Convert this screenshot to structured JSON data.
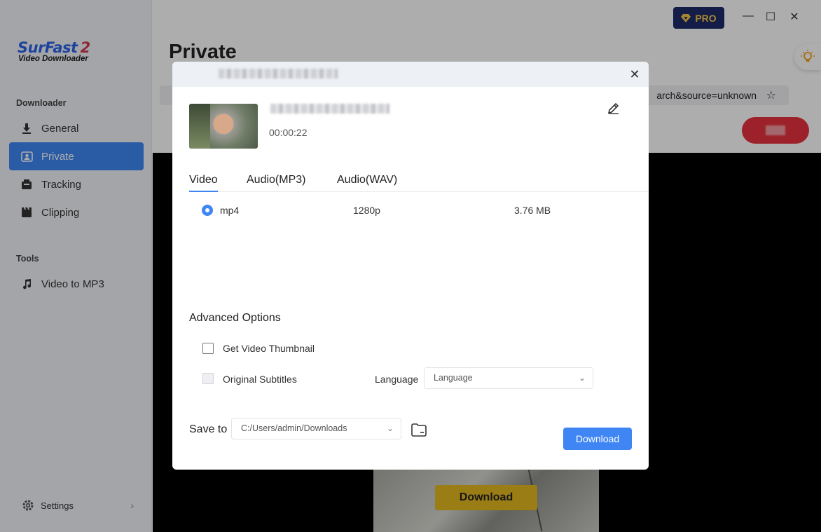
{
  "app": {
    "brand": "SurFast",
    "brand_version": "2",
    "brand_subtitle": "Video Downloader"
  },
  "sidebar": {
    "section_downloader": "Downloader",
    "items": [
      {
        "label": "General",
        "icon": "download-icon"
      },
      {
        "label": "Private",
        "icon": "private-icon",
        "active": true
      },
      {
        "label": "Tracking",
        "icon": "tracking-icon"
      },
      {
        "label": "Clipping",
        "icon": "clipping-icon"
      }
    ],
    "section_tools": "Tools",
    "tools": [
      {
        "label": "Video to MP3",
        "icon": "music-note-icon"
      }
    ],
    "settings_label": "Settings"
  },
  "header": {
    "page_title": "Private",
    "pro_label": "PRO",
    "url_tail": "arch&source=unknown"
  },
  "video": {
    "overlay_button_label": "Download"
  },
  "dialog": {
    "duration": "00:00:22",
    "tabs": [
      {
        "label": "Video",
        "active": true
      },
      {
        "label": "Audio(MP3)"
      },
      {
        "label": "Audio(WAV)"
      }
    ],
    "formats": [
      {
        "format": "mp4",
        "resolution": "1280p",
        "size": "3.76 MB",
        "selected": true
      }
    ],
    "advanced_title": "Advanced Options",
    "options": {
      "thumbnail_label": "Get Video Thumbnail",
      "subtitles_label": "Original Subtitles",
      "language_label": "Language",
      "language_placeholder": "Language"
    },
    "save_to_label": "Save to",
    "save_path": "C:/Users/admin/Downloads",
    "download_label": "Download"
  },
  "colors": {
    "accent": "#3f86f4",
    "pro_bg": "#1c2c6b",
    "pro_text": "#f3c54b",
    "red_button": "#e8323f",
    "yellow_button": "#e4b820"
  }
}
